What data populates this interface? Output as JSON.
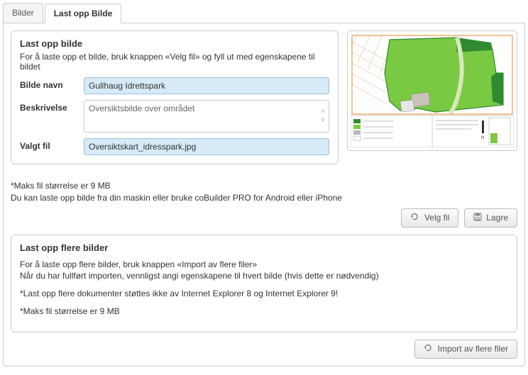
{
  "tabs": {
    "images_label": "Bilder",
    "upload_label": "Last opp Bilde"
  },
  "upload_box": {
    "title": "Last opp bilde",
    "intro": "For å laste opp et bilde, bruk knappen «Velg fil» og fyll ut med egenskapene til bildet",
    "image_name_label": "Bilde navn",
    "image_name_value": "Gullhaug Idrettspark",
    "description_label": "Beskrivelse",
    "description_value": "Oversiktsbilde over området",
    "selected_file_label": "Valgt fil",
    "selected_file_value": "Oversiktskart_idresspark.jpg",
    "note_size": "*Maks fil størrelse er 9 MB",
    "note_device": "Du kan laste opp bilde fra din maskin eller bruke coBuilder PRO for Android eller iPhone",
    "choose_file_btn": "Velg fil",
    "save_btn": "Lagre"
  },
  "multi_box": {
    "title": "Last opp flere bilder",
    "p1": "For å laste opp flere bilder, bruk knappen «Import av flere filer»",
    "p2": "Når du har fullført importen, vennligst angi egenskapene til hvert bilde (hvis dette er nødvendig)",
    "p3": "*Last opp flere dokumenter støttes ikke av Internet Explorer 8 og Internet Explorer 9!",
    "p4": "*Maks fil størrelse er 9 MB",
    "import_btn": "Import av flere filer"
  }
}
